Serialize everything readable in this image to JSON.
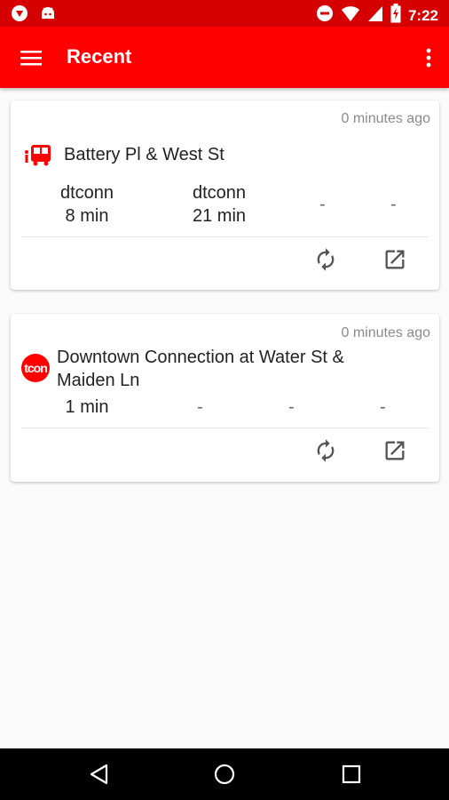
{
  "status_bar": {
    "time": "7:22",
    "icons_left": [
      "shield-icon",
      "android-icon"
    ],
    "icons_right": [
      "do-not-disturb-icon",
      "wifi-icon",
      "signal-icon",
      "battery-icon"
    ]
  },
  "app_bar": {
    "title": "Recent",
    "background": "#ff0000"
  },
  "cards": [
    {
      "ago": "0 minutes ago",
      "stop_name": "Battery Pl & West St",
      "icon": "bus-icon",
      "arrivals": [
        {
          "route": "dtconn",
          "time": "8 min"
        },
        {
          "route": "dtconn",
          "time": "21 min"
        },
        {
          "route": "",
          "time": "-"
        },
        {
          "route": "",
          "time": "-"
        }
      ]
    },
    {
      "ago": "0 minutes ago",
      "stop_name_line1": "Downtown Connection at Water St &",
      "stop_name_line2": "Maiden Ln",
      "icon_text": "tcon",
      "arrivals": [
        {
          "time": "1 min"
        },
        {
          "time": "-"
        },
        {
          "time": "-"
        },
        {
          "time": "-"
        }
      ]
    }
  ],
  "colors": {
    "status_bar": "#d50000",
    "accent": "#ff0000"
  }
}
